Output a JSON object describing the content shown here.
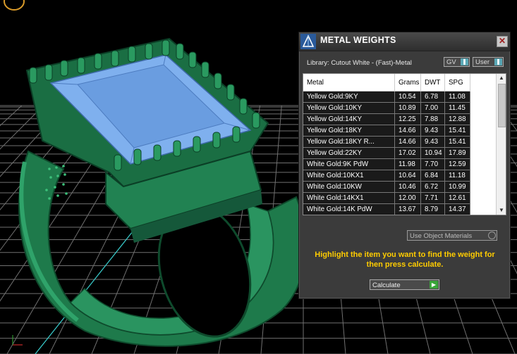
{
  "panel": {
    "title": "METAL WEIGHTS",
    "library_label": "Library: Cutout White - (Fast)-Metal",
    "toggle_gv": "GV",
    "toggle_user": "User",
    "close_symbol": "✕",
    "use_object_materials": "Use Object Materials",
    "hint": "Highlight the item you want to find the weight for then press calculate.",
    "calculate_label": "Calculate"
  },
  "table": {
    "columns": [
      "Metal",
      "Grams",
      "DWT",
      "SPG"
    ],
    "rows": [
      [
        "Yellow Gold:9KY",
        "10.54",
        "6.78",
        "11.08"
      ],
      [
        "Yellow Gold:10KY",
        "10.89",
        "7.00",
        "11.45"
      ],
      [
        "Yellow Gold:14KY",
        "12.25",
        "7.88",
        "12.88"
      ],
      [
        "Yellow Gold:18KY",
        "14.66",
        "9.43",
        "15.41"
      ],
      [
        "Yellow Gold:18KY R...",
        "14.66",
        "9.43",
        "15.41"
      ],
      [
        "Yellow Gold:22KY",
        "17.02",
        "10.94",
        "17.89"
      ],
      [
        "White Gold:9K PdW",
        "11.98",
        "7.70",
        "12.59"
      ],
      [
        "White Gold:10KX1",
        "10.64",
        "6.84",
        "11.18"
      ],
      [
        "White Gold:10KW",
        "10.46",
        "6.72",
        "10.99"
      ],
      [
        "White Gold:14KX1",
        "12.00",
        "7.71",
        "12.61"
      ],
      [
        "White Gold:14K PdW",
        "13.67",
        "8.79",
        "14.37"
      ]
    ]
  },
  "icons": {
    "panel_icon": "metal-weights-app-icon",
    "close": "close-icon",
    "scroll_up": "scroll-up-icon",
    "scroll_down": "scroll-down-icon",
    "calculate_arrow": "play-arrow-icon",
    "viewport_logo": "ring-logo-icon"
  },
  "colors": {
    "hint_text": "#ffcc00",
    "ring_green": "#1f7a4a",
    "gem_blue": "#7fb0ee",
    "grid_line": "#7a7a7a",
    "calculate_arrow": "#3aa53a"
  }
}
